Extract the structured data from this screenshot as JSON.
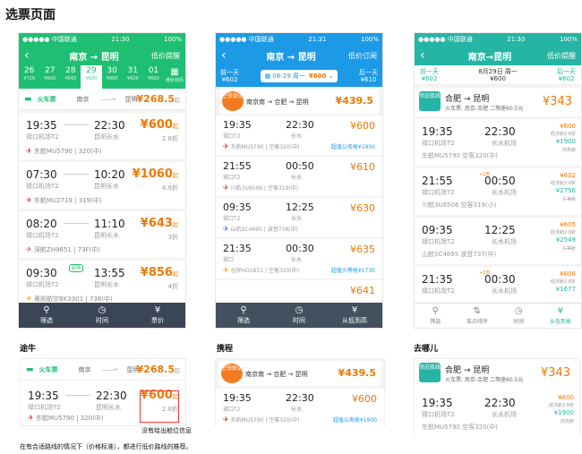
{
  "page_title": "选票页面",
  "status": {
    "carrier": "●●●●● 中国联通",
    "battery": "100%",
    "time1": "21:30",
    "time2": "21:31",
    "time3": "21:30"
  },
  "p1": {
    "nav_title": "南京 → 昆明",
    "nav_right": "低价提醒",
    "dates": [
      {
        "n": "26",
        "p": "¥729"
      },
      {
        "n": "27",
        "p": "¥600"
      },
      {
        "n": "28",
        "p": "¥643"
      },
      {
        "n": "29",
        "p": "¥600"
      },
      {
        "n": "30",
        "p": "¥600"
      },
      {
        "n": "31",
        "p": "¥600"
      },
      {
        "n": "01",
        "p": "¥600"
      }
    ],
    "selected_date": "29",
    "cal_label": "低价日历",
    "train": {
      "label": "火车票",
      "from": "南京",
      "to": "昆明",
      "price": "¥268.5",
      "suffix": "起"
    },
    "flights": [
      {
        "dep": "19:35",
        "arr": "22:30",
        "dep_ap": "禄口机场T2",
        "arr_ap": "昆明长水",
        "airline": "东航MU5790 | 320(中)",
        "price": "¥600",
        "suffix": "起",
        "disc": "2.8折"
      },
      {
        "dep": "07:30",
        "arr": "10:20",
        "dep_ap": "禄口机场T2",
        "arr_ap": "昆明长水",
        "airline": "东航MU2719 | 319(中)",
        "price": "¥1060",
        "suffix": "起",
        "disc": "4.9折"
      },
      {
        "dep": "08:20",
        "arr": "11:10",
        "dep_ap": "禄口机场T2",
        "arr_ap": "昆明长水",
        "airline": "深航ZH9651 | 73F(中)",
        "price": "¥643",
        "suffix": "起",
        "disc": "3折"
      },
      {
        "dep": "09:30",
        "arr": "13:55",
        "dep_ap": "禄口机场T2",
        "arr_ap": "昆明长水",
        "airline": "奥凯航空BK3301 | 738(中)",
        "price": "¥856",
        "suffix": "起",
        "disc": "4折",
        "tag": "经停"
      },
      {
        "dep": "",
        "arr": "",
        "dep_ap": "",
        "arr_ap": "",
        "airline": "东方航HO1681 | 320(中)",
        "price": "",
        "suffix": "",
        "disc": ""
      }
    ],
    "tabs": [
      "筛选",
      "时间",
      "票价"
    ]
  },
  "p2": {
    "nav_title": "南京 → 昆明",
    "nav_right": "低价订阅",
    "prev": "前一天",
    "prev_p": "¥602",
    "next": "后一天",
    "next_p": "¥610",
    "mid_date": "08-29 周一",
    "mid_price": "¥600",
    "combo": {
      "badge": "空铁联运",
      "text": "南京南 → 合肥 → 昆明",
      "price": "¥439.5"
    },
    "flights": [
      {
        "dep": "19:35",
        "arr": "22:30",
        "dep_ap": "禄口T2",
        "arr_ap": "长水",
        "airline": "东航MU5790 | 空客320(中)",
        "price": "¥600",
        "extra": "超值公务舱¥1900"
      },
      {
        "dep": "21:55",
        "arr": "00:50",
        "dep_ap": "禄口T2",
        "arr_ap": "长水",
        "airline": "川航3U8506 | 空客319(中)",
        "price": "¥610",
        "extra": ""
      },
      {
        "dep": "09:35",
        "arr": "12:25",
        "dep_ap": "禄口T2",
        "arr_ap": "长水",
        "airline": "山航SC4695 | 波音738(中)",
        "price": "¥630",
        "extra": ""
      },
      {
        "dep": "21:35",
        "arr": "00:30",
        "dep_ap": "禄口",
        "arr_ap": "长水",
        "airline": "吉祥HO1651 | 空客320(中)",
        "price": "¥635",
        "extra": "超值头等舱¥1730"
      },
      {
        "dep": "",
        "arr": "",
        "dep_ap": "",
        "arr_ap": "",
        "airline": "",
        "price": "¥641",
        "extra": ""
      }
    ],
    "tabs": [
      "筛选",
      "时间",
      "从低到高"
    ]
  },
  "p3": {
    "nav_title": "南京→昆明",
    "nav_right": "低价提醒",
    "prev": "前一天",
    "prev_p": "¥602",
    "mid_date": "8月29日 周一",
    "mid_price": "¥600",
    "next": "后一天",
    "next_p": "¥602",
    "combo": {
      "badge": "邻近航线",
      "title": "合肥 → 昆明",
      "sub": "火车票: 南京-合肥 二等座60.5元",
      "price": "¥343"
    },
    "flights": [
      {
        "dep": "19:35",
        "arr": "22:30",
        "dep_ap": "禄口机场T2",
        "arr_ap": "长水机场",
        "airline": "东航MU5790  空客320(中)",
        "r1": "¥600",
        "r2": "经济舱2.8折",
        "r3": "¥1900",
        "r4": "商务舱",
        "plus": ""
      },
      {
        "dep": "21:55",
        "arr": "00:50",
        "dep_ap": "禄口机场T2",
        "arr_ap": "长水机场",
        "airline": "川航3U8506  空客319(小)",
        "r1": "¥602",
        "r2": "经济舱2.8折",
        "r3": "¥2756",
        "r4": "头等舱",
        "plus": "+1天"
      },
      {
        "dep": "09:35",
        "arr": "12:25",
        "dep_ap": "禄口机场T2",
        "arr_ap": "长水机场",
        "airline": "山航SC4695  波音737(中)",
        "r1": "¥605",
        "r2": "经济舱2.8折",
        "r3": "¥2549",
        "r4": "头等舱",
        "plus": ""
      },
      {
        "dep": "21:35",
        "arr": "00:30",
        "dep_ap": "禄口机场T2",
        "arr_ap": "长水机场",
        "airline": "",
        "r1": "¥608",
        "r2": "经济舱2.8折",
        "r3": "¥1677",
        "r4": "",
        "plus": "+1天"
      }
    ],
    "tabs": [
      "筛选",
      "准点排序",
      "时间",
      "从低到高"
    ]
  },
  "bottom": {
    "label1": "途牛",
    "label2": "携程",
    "label3": "去哪儿",
    "note_red": "没有给出舱位信息",
    "note": "在有合适路线的情况下（价格标准），都进行低价路线的推荐。"
  }
}
